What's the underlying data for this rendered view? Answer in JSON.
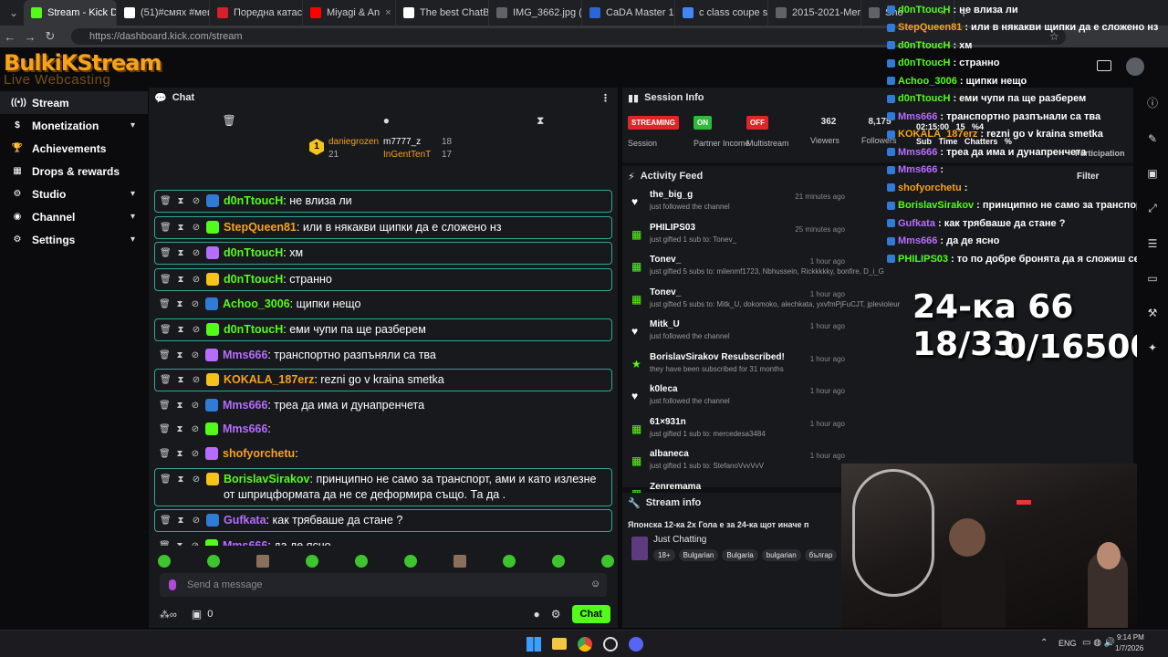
{
  "browser": {
    "tabs": [
      {
        "label": "Stream - Kick Da",
        "color": "#53fc18",
        "active": true
      },
      {
        "label": "(51)#смях #меш",
        "color": "#ffffff"
      },
      {
        "label": "Поредна катаст",
        "color": "#d6202b"
      },
      {
        "label": "Miyagi & An",
        "color": "#ff0000"
      },
      {
        "label": "The best ChatBo",
        "color": "#ffffff"
      },
      {
        "label": "IMG_3662.jpg (5",
        "color": "#5f6368"
      },
      {
        "label": "CaDA Master 1:8",
        "color": "#2b66d6"
      },
      {
        "label": "c class coupe sp",
        "color": "#4285f4"
      },
      {
        "label": "2015-2021-Merc",
        "color": "#5f6368"
      },
      {
        "label": "Sho",
        "color": "#5f6368"
      }
    ],
    "url": "https://dashboard.kick.com/stream"
  },
  "logo": {
    "line1": "BulkiKStream",
    "line2": "Live Webcasting Services"
  },
  "sidebar": {
    "items": [
      {
        "label": "Stream",
        "icon": "broadcast-icon",
        "glyph": "((•))",
        "chev": false
      },
      {
        "label": "Monetization",
        "icon": "dollar-icon",
        "glyph": "$",
        "chev": true
      },
      {
        "label": "Achievements",
        "icon": "trophy-icon",
        "glyph": "🏆",
        "chev": false
      },
      {
        "label": "Drops & rewards",
        "icon": "gift-icon",
        "glyph": "▦",
        "chev": false
      },
      {
        "label": "Studio",
        "icon": "gear-icon",
        "glyph": "⚙",
        "chev": true
      },
      {
        "label": "Channel",
        "icon": "user-icon",
        "glyph": "◉",
        "chev": true
      },
      {
        "label": "Settings",
        "icon": "settings-icon",
        "glyph": "⚙",
        "chev": true
      }
    ]
  },
  "chat": {
    "title": "Chat",
    "top_gifters": [
      {
        "name": "daniegrozen",
        "count": "21"
      },
      {
        "name": "m7777_z",
        "count": "18"
      },
      {
        "name": "InGentTenT",
        "count": "17"
      }
    ],
    "messages": [
      {
        "user": "d0nTtoucH",
        "text": ": не влиза ли",
        "color": "#53fc18",
        "boxed": true
      },
      {
        "user": "StepQueen81",
        "text": ": или в някакви щипки да е сложено нз",
        "color": "#f6a21a",
        "boxed": true
      },
      {
        "user": "d0nTtoucH",
        "text": ": хм",
        "color": "#53fc18",
        "boxed": true
      },
      {
        "user": "d0nTtoucH",
        "text": ": странно",
        "color": "#53fc18",
        "boxed": true
      },
      {
        "user": "Achoo_3006",
        "text": ": щипки нещо",
        "color": "#53fc18",
        "boxed": false
      },
      {
        "user": "d0nTtoucH",
        "text": ": еми чупи па ще разберем",
        "color": "#53fc18",
        "boxed": true
      },
      {
        "user": "Mms666",
        "text": ": транспортно разпъняли са тва",
        "color": "#b66dff",
        "boxed": false
      },
      {
        "user": "KOKALA_187erz",
        "text": ": rezni go v kraina smetka",
        "color": "#f6a21a",
        "boxed": true
      },
      {
        "user": "Mms666",
        "text": ": треа да има и дунапренчета",
        "color": "#b66dff",
        "boxed": false
      },
      {
        "user": "Mms666",
        "text": ":",
        "color": "#b66dff",
        "boxed": false
      },
      {
        "user": "shofyorchetu",
        "text": ":",
        "color": "#f6a21a",
        "boxed": false
      },
      {
        "user": "BorislavSirakov",
        "text": ": принципно не само за транспорт, ами и като излезне от шприцформата да не се деформира също. Та да .",
        "color": "#53fc18",
        "boxed": true
      },
      {
        "user": "Gufkata",
        "text": ": как трябваше да стане ?",
        "color": "#b66dff",
        "boxed": true
      },
      {
        "user": "Mms666",
        "text": ": да де ясно",
        "color": "#b66dff",
        "boxed": false
      },
      {
        "user": "PHILIPS03",
        "text": ": то по добре бронята да я сложиш сега за да поеме формата на колата",
        "color": "#53fc18",
        "boxed": false
      }
    ],
    "input_placeholder": "Send a message",
    "points": "0",
    "send_label": "Chat"
  },
  "session": {
    "title": "Session Info",
    "stats": [
      {
        "badge": "STREAMING",
        "badge_color": "#e0252a",
        "label": "Session"
      },
      {
        "badge": "ON",
        "badge_color": "#2fba3a",
        "label": "Partner Income"
      },
      {
        "badge": "OFF",
        "badge_color": "#e0252a",
        "label": "Multistream"
      },
      {
        "value": "362",
        "label": "Viewers"
      },
      {
        "value": "8,175",
        "label": "Followers"
      }
    ]
  },
  "activity": {
    "title": "Activity Feed",
    "filter": "Filter",
    "items": [
      {
        "icon": "heart-icon",
        "name": "the_big_g",
        "sub": "just followed the channel",
        "time": "21 minutes ago"
      },
      {
        "icon": "gift-icon",
        "name": "PHILIPS03",
        "sub": "just gifted 1 sub to: Tonev_",
        "time": "25 minutes ago"
      },
      {
        "icon": "gift-icon",
        "name": "Tonev_",
        "sub": "just gifted 5 subs to: milenmf1723, Nbhussein, Rickkkkky, bonfire, D_i_G",
        "time": "1 hour ago"
      },
      {
        "icon": "gift-icon",
        "name": "Tonev_",
        "sub": "just gifted 5 subs to: Mitk_U, dokomoko, alechkata, yxvfmPjFuCJT, jplevioleur",
        "time": "1 hour ago"
      },
      {
        "icon": "heart-icon",
        "name": "Mitk_U",
        "sub": "just followed the channel",
        "time": "1 hour ago"
      },
      {
        "icon": "star-icon",
        "name": "BorislavSirakov Resubscribed!",
        "sub": "they have been subscribed for 31 months",
        "time": "1 hour ago"
      },
      {
        "icon": "heart-icon",
        "name": "k0leca",
        "sub": "just followed the channel",
        "time": "1 hour ago"
      },
      {
        "icon": "gift-icon",
        "name": "61×931n",
        "sub": "just gifted 1 sub to: mercedesa3484",
        "time": "1 hour ago"
      },
      {
        "icon": "gift-icon",
        "name": "albaneca",
        "sub": "just gifted 1 sub to: StefanoVvvVvV",
        "time": "1 hour ago"
      },
      {
        "icon": "gift-icon",
        "name": "Zenremama",
        "sub": "",
        "time": ""
      }
    ]
  },
  "stream_info": {
    "title": "Stream info",
    "stream_title": "Японска 12-ка 2х Гола е за 24-ка щот иначе п",
    "category": "Just Chatting",
    "tags": [
      "18+",
      "Bulgarian",
      "Bulgaria",
      "bulgarian",
      "българ"
    ]
  },
  "overlay": {
    "chat_lines": [
      {
        "user": "d0nTtoucH",
        "text": ": не влиза ли",
        "color": "#53fc18"
      },
      {
        "user": "StepQueen81",
        "text": ": или в някакви щипки да е сложено нз",
        "color": "#f6a21a"
      },
      {
        "user": "d0nTtoucH",
        "text": ": хм",
        "color": "#53fc18"
      },
      {
        "user": "d0nTtoucH",
        "text": ": странно",
        "color": "#53fc18"
      },
      {
        "user": "Achoo_3006",
        "text": ": щипки нещо",
        "color": "#53fc18"
      },
      {
        "user": "d0nTtoucH",
        "text": ": еми чупи па ще разберем",
        "color": "#53fc18"
      },
      {
        "user": "Mms666",
        "text": ": транспортно разпънали са тва",
        "color": "#b66dff"
      },
      {
        "user": "KOKALA_187erz",
        "text": ": rezni go v kraina smetka",
        "color": "#f6a21a"
      },
      {
        "user": "Mms666",
        "text": ": треа да има и дунапренчета",
        "color": "#b66dff"
      },
      {
        "user": "Mms666",
        "text": ":",
        "color": "#b66dff"
      },
      {
        "user": "shofyorchetu",
        "text": ":",
        "color": "#f6a21a"
      },
      {
        "user": "BorislavSirakov",
        "text": ": принципно не само за транспорт,ами",
        "color": "#53fc18"
      },
      {
        "user": "Gufkata",
        "text": ": как трябваше да стане ?",
        "color": "#b66dff"
      },
      {
        "user": "Mms666",
        "text": ": да де ясно",
        "color": "#b66dff"
      },
      {
        "user": "PHILIPS03",
        "text": ": то по добре бронята да я сложиш сега за",
        "color": "#53fc18"
      }
    ],
    "counter_line1": "24-ка 66 18/33",
    "counter_line2": "0/16500",
    "stat_values": "02:15:00   15   %4",
    "stat_labels": "Sub   Time   Chatters   %",
    "participation": "Participation"
  },
  "taskbar": {
    "lang": "ENG",
    "time": "9:14 PM",
    "date": "1/7/2026"
  }
}
